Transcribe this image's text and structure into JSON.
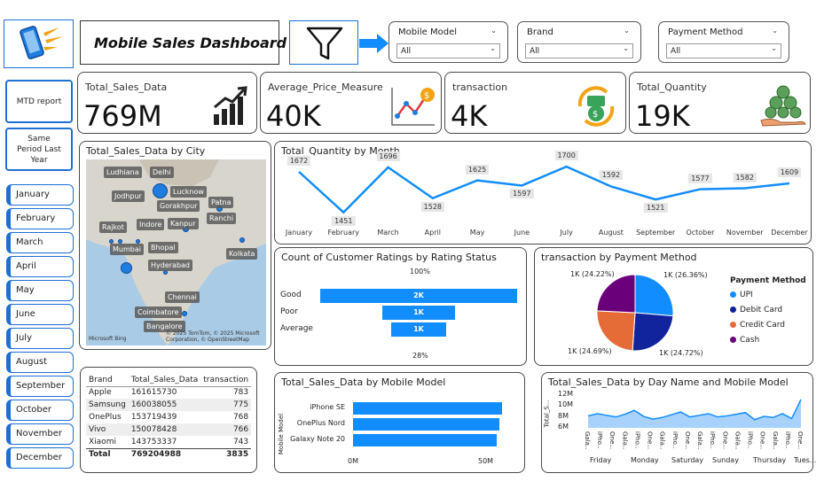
{
  "header": {
    "title": "Mobile Sales Dashboard"
  },
  "filters": {
    "mobile_model": {
      "label": "Mobile Model",
      "value": "All"
    },
    "brand": {
      "label": "Brand",
      "value": "All"
    },
    "payment_method": {
      "label": "Payment Method",
      "value": "All"
    }
  },
  "nav": {
    "mtd": "MTD report",
    "same_period": "Same Period Last Year"
  },
  "months": [
    "January",
    "February",
    "March",
    "April",
    "May",
    "June",
    "July",
    "August",
    "September",
    "October",
    "November",
    "December"
  ],
  "kpis": [
    {
      "label": "Total_Sales_Data",
      "value": "769M",
      "icon": "bar-growth-icon"
    },
    {
      "label": "Average_Price_Measure",
      "value": "40K",
      "icon": "price-trend-icon"
    },
    {
      "label": "transaction",
      "value": "4K",
      "icon": "money-cycle-icon"
    },
    {
      "label": "Total_Quantity",
      "value": "19K",
      "icon": "coins-hand-icon"
    }
  ],
  "city_map": {
    "title": "Total_Sales_Data by City",
    "cities": [
      "Ludhiana",
      "Delhi",
      "Jodhpur",
      "Lucknow",
      "Gorakhpur",
      "Patna",
      "Ranchi",
      "Rajkot",
      "Indore",
      "Kanpur",
      "Mumbai",
      "Bhopal",
      "Hyderabad",
      "Kolkata",
      "Chennai",
      "Coimbatore",
      "Bangalore"
    ],
    "attribution": "© 2025 TomTom, © 2025 Microsoft Corporation, © OpenStreetMap",
    "logo": "Microsoft Bing"
  },
  "quantity_by_month": {
    "title": "Total_Quantity by Month"
  },
  "ratings": {
    "title": "Count of Customer Ratings by Rating Status",
    "top_pct": "100%",
    "bottom_pct": "28%"
  },
  "payment": {
    "title": "transaction by Payment Method",
    "legend_title": "Payment Method",
    "slice_labels": [
      "1K (26.36%)",
      "1K (24.72%)",
      "1K (24.69%)",
      "1K (24.22%)"
    ]
  },
  "brand_table": {
    "headers": [
      "Brand",
      "Total_Sales_Data",
      "transaction"
    ],
    "rows": [
      [
        "Apple",
        "161615730",
        "783"
      ],
      [
        "Samsung",
        "160038055",
        "775"
      ],
      [
        "OnePlus",
        "153719439",
        "768"
      ],
      [
        "Vivo",
        "150078428",
        "766"
      ],
      [
        "Xiaomi",
        "143753337",
        "743"
      ]
    ],
    "total": [
      "Total",
      "769204988",
      "3835"
    ]
  },
  "model_sales": {
    "title": "Total_Sales_Data by Mobile Model",
    "axis_title": "Mobile Model",
    "ticks": [
      "0M",
      "50M"
    ]
  },
  "day_sales": {
    "title": "Total_Sales_Data by Day Name and Mobile Model",
    "axis_title": "Total_S...",
    "subcats": [
      "Gala...",
      "iPho...",
      "One..."
    ],
    "days": [
      "Friday",
      "Monday",
      "Saturday",
      "Sunday",
      "Thursday",
      "Tues..."
    ]
  },
  "chart_data": [
    {
      "type": "line",
      "title": "Total_Quantity by Month",
      "categories": [
        "January",
        "February",
        "March",
        "April",
        "May",
        "June",
        "July",
        "August",
        "September",
        "October",
        "November",
        "December"
      ],
      "values": [
        1672,
        1451,
        1696,
        1528,
        1625,
        1597,
        1700,
        1592,
        1521,
        1577,
        1582,
        1609
      ],
      "color": "#118dff"
    },
    {
      "type": "bar",
      "title": "Count of Customer Ratings by Rating Status",
      "categories": [
        "Good",
        "Poor",
        "Average"
      ],
      "values": [
        2000,
        1000,
        1000
      ],
      "data_labels": [
        "2K",
        "1K",
        "1K"
      ],
      "color": "#118dff"
    },
    {
      "type": "pie",
      "title": "transaction by Payment Method",
      "categories": [
        "UPI",
        "Debit Card",
        "Credit Card",
        "Cash"
      ],
      "values": [
        26.36,
        24.72,
        24.69,
        24.22
      ],
      "colors": [
        "#118dff",
        "#12239e",
        "#e66c37",
        "#6b007b"
      ]
    },
    {
      "type": "bar",
      "title": "Total_Sales_Data by Mobile Model",
      "categories": [
        "iPhone SE",
        "OnePlus Nord",
        "Galaxy Note 20"
      ],
      "values": [
        56,
        55,
        54
      ],
      "xlim": [
        0,
        60
      ],
      "color": "#118dff"
    },
    {
      "type": "area",
      "title": "Total_Sales_Data by Day Name and Mobile Model",
      "y_ticks": [
        "12M",
        "10M",
        "8M",
        "6M"
      ],
      "values": [
        8.2,
        8.6,
        8.3,
        8.0,
        8.5,
        9.2,
        8.1,
        7.6,
        7.9,
        8.4,
        8.9,
        8.0,
        8.3,
        8.6,
        8.0,
        8.2,
        8.5,
        8.8,
        7.5,
        8.1,
        7.9,
        8.6,
        7.7,
        11.2
      ],
      "ylim": [
        6,
        12
      ],
      "color": "#118dff"
    }
  ]
}
